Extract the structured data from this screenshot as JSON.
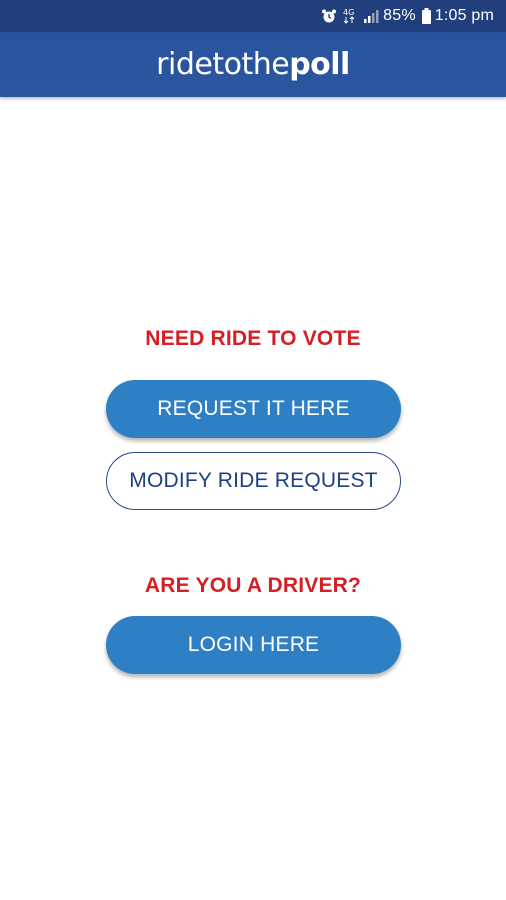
{
  "status_bar": {
    "battery": "85%",
    "time": "1:05 pm",
    "network": "4G",
    "icons": [
      "alarm-icon",
      "network-4g-icon",
      "signal-icon",
      "battery-icon"
    ]
  },
  "header": {
    "title_light": "ridetothe",
    "title_bold": "poll"
  },
  "rider_section": {
    "label": "NEED RIDE TO VOTE",
    "request_button": "REQUEST IT HERE",
    "modify_button": "MODIFY RIDE REQUEST"
  },
  "driver_section": {
    "label": "ARE YOU A DRIVER?",
    "login_button": "LOGIN HERE"
  },
  "colors": {
    "header": "#2b56a0",
    "status_bar": "#223f7d",
    "accent_red": "#d41f24",
    "button_blue": "#2f7fc5",
    "outline_text": "#1d3f84"
  }
}
